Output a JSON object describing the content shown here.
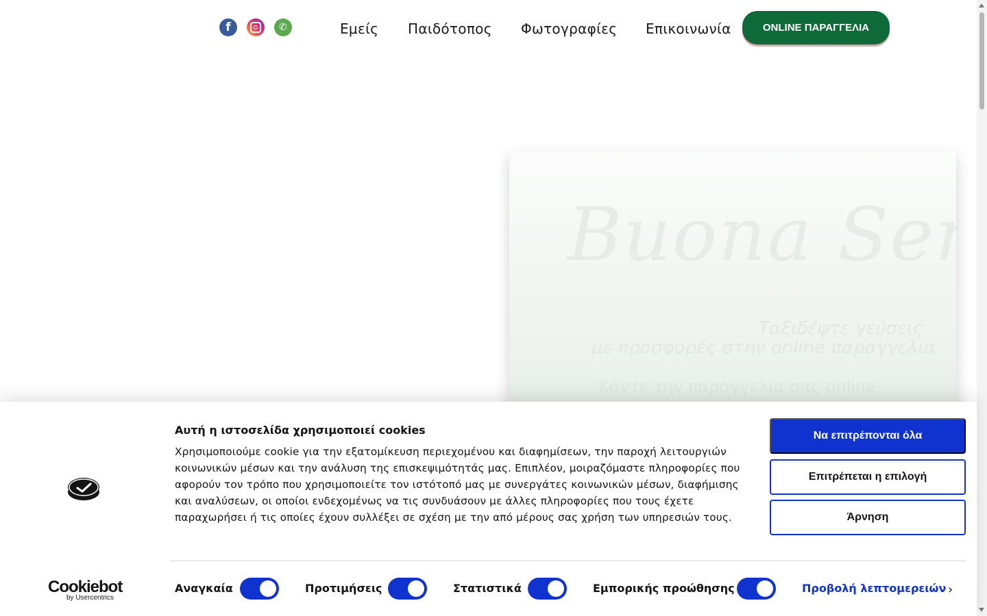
{
  "header": {
    "social": [
      {
        "name": "facebook-icon",
        "glyph": "f"
      },
      {
        "name": "instagram-icon",
        "glyph": ""
      },
      {
        "name": "phone-icon",
        "glyph": "✆"
      }
    ],
    "nav": [
      "Εμείς",
      "Παιδότοπος",
      "Φωτογραφίες",
      "Επικοινωνία"
    ],
    "order_button": "ONLINE ΠΑΡΑΓΓΕΛΙΑ"
  },
  "hero": {
    "title": "Buona Sera",
    "subtitle_line1": "Ταξιδέψτε γεύσεις",
    "subtitle_line2": "με προσφορές στην online παραγγελία",
    "cta_text": "Κάντε την παραγγελία σας online"
  },
  "cookie_banner": {
    "title": "Αυτή η ιστοσελίδα χρησιμοποιεί cookies",
    "body": "Χρησιμοποιούμε cookie για την εξατομίκευση περιεχομένου και διαφημίσεων, την παροχή λειτουργιών κοινωνικών μέσων και την ανάλυση της επισκεψιμότητάς μας. Επιπλέον, μοιραζόμαστε πληροφορίες που αφορούν τον τρόπο που χρησιμοποιείτε τον ιστότοπό μας με συνεργάτες κοινωνικών μέσων, διαφήμισης και αναλύσεων, οι οποίοι ενδεχομένως να τις συνδυάσουν με άλλες πληροφορίες που τους έχετε παραχωρήσει ή τις οποίες έχουν συλλέξει σε σχέση με την από μέρους σας χρήση των υπηρεσιών τους.",
    "allow_all": "Να επιτρέπονται όλα",
    "allow_selection": "Επιτρέπεται η επιλογή",
    "deny": "Άρνηση",
    "brand": "Cookiebot",
    "brand_sub": "by Usercentrics",
    "toggles": [
      {
        "label": "Αναγκαία",
        "on": true
      },
      {
        "label": "Προτιμήσεις",
        "on": true
      },
      {
        "label": "Στατιστικά",
        "on": true
      },
      {
        "label": "Εμπορικής προώθησης",
        "on": true
      }
    ],
    "details_link": "Προβολή λεπτομερειών",
    "accent_color": "#1032cf"
  },
  "colors": {
    "order_button_bg": "#0f6a3a",
    "facebook": "#3b5a99",
    "phone": "#5ca84f"
  }
}
